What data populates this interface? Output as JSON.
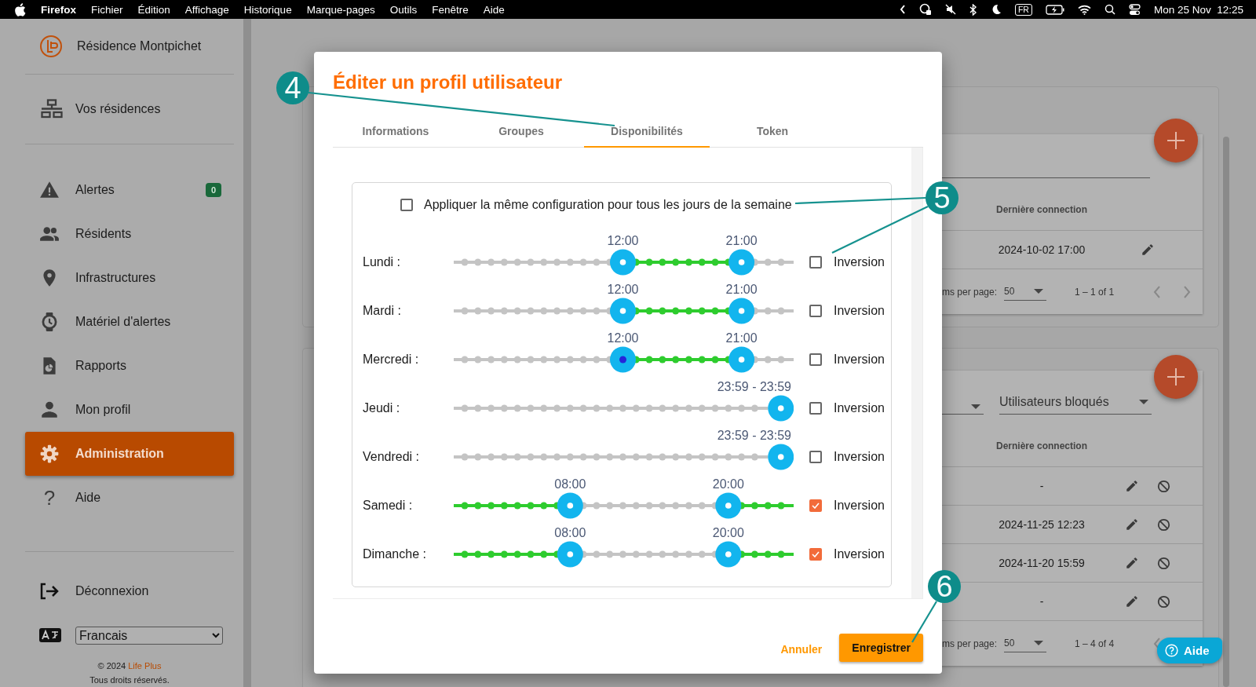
{
  "menu_bar": {
    "app": "Firefox",
    "menus": [
      "Fichier",
      "Édition",
      "Affichage",
      "Historique",
      "Marque-pages",
      "Outils",
      "Fenêtre",
      "Aide"
    ],
    "input_source": "FR",
    "clock": "Mon 25 Nov  12:25"
  },
  "sidebar": {
    "residence": "Résidence Montpichet",
    "top_item": "Vos résidences",
    "items": [
      {
        "label": "Alertes",
        "kind": "alert",
        "badge": "0",
        "selected": false
      },
      {
        "label": "Résidents",
        "kind": "people",
        "selected": false
      },
      {
        "label": "Infrastructures",
        "kind": "pin",
        "selected": false
      },
      {
        "label": "Matériel d'alertes",
        "kind": "watch",
        "selected": false
      },
      {
        "label": "Rapports",
        "kind": "report",
        "selected": false
      },
      {
        "label": "Mon profil",
        "kind": "person",
        "selected": false
      },
      {
        "label": "Administration",
        "kind": "gear",
        "selected": true
      },
      {
        "label": "Aide",
        "kind": "help",
        "glyph": "?",
        "selected": false
      }
    ],
    "logout": "Déconnexion",
    "language": "Francais",
    "copyright": "© 2024 ",
    "brand": "Life Plus",
    "rights": "Tous droits réservés."
  },
  "panels": [
    {
      "filters": [
        {
          "kind": "field"
        }
      ],
      "column_header": "Dernière connection",
      "rows": [
        "2024-10-02 17:00"
      ],
      "items_label": "ms per page:",
      "per_page": "50",
      "range": "1 – 1 of 1",
      "pager_next": true
    },
    {
      "filters": [
        {
          "kind": "select"
        },
        {
          "kind": "select",
          "value": "Utilisateurs bloqués"
        }
      ],
      "column_header": "Dernière connection",
      "block_column": true,
      "rows": [
        "-",
        "2024-11-25 12:23",
        "2024-11-20 15:59",
        "-"
      ],
      "items_label": "ms per page:",
      "per_page": "50",
      "range": "1 – 4 of 4"
    }
  ],
  "dialog": {
    "title": "Éditer un profil utilisateur",
    "tabs": [
      {
        "label": "Informations",
        "selected": false
      },
      {
        "label": "Groupes",
        "selected": false
      },
      {
        "label": "Disponibilités",
        "selected": true
      },
      {
        "label": "Token",
        "selected": false
      }
    ],
    "apply_all": {
      "label": "Appliquer la même configuration pour tous les jours de la semaine",
      "checked": false
    },
    "days": [
      {
        "name": "Lundi :",
        "thumbs": [
          {
            "label": "12:00",
            "level": 0.5
          },
          {
            "label": "21:00",
            "level": 0.875
          }
        ],
        "inversion": {
          "label": "Inversion",
          "checked": false
        }
      },
      {
        "name": "Mardi :",
        "thumbs": [
          {
            "label": "12:00",
            "level": 0.5
          },
          {
            "label": "21:00",
            "level": 0.875
          }
        ],
        "inversion": {
          "label": "Inversion",
          "checked": false
        }
      },
      {
        "name": "Mercredi :",
        "thumbs": [
          {
            "label": "12:00",
            "level": 0.5,
            "focused": true
          },
          {
            "label": "21:00",
            "level": 0.875
          }
        ],
        "inversion": {
          "label": "Inversion",
          "checked": false
        }
      },
      {
        "name": "Jeudi :",
        "thumbs": [
          {
            "label": "23:59 - 23:59",
            "level": 0.9993
          }
        ],
        "inversion": {
          "label": "Inversion",
          "checked": false
        }
      },
      {
        "name": "Vendredi :",
        "thumbs": [
          {
            "label": "23:59 - 23:59",
            "level": 0.9993
          }
        ],
        "inversion": {
          "label": "Inversion",
          "checked": false
        }
      },
      {
        "name": "Samedi :",
        "thumbs": [
          {
            "label": "08:00",
            "level": 0.3333
          },
          {
            "label": "20:00",
            "level": 0.8333
          }
        ],
        "inversion": {
          "label": "Inversion",
          "checked": true
        }
      },
      {
        "name": "Dimanche :",
        "thumbs": [
          {
            "label": "08:00",
            "level": 0.3333
          },
          {
            "label": "20:00",
            "level": 0.8333
          }
        ],
        "inversion": {
          "label": "Inversion",
          "checked": true
        }
      }
    ],
    "buttons": [
      {
        "label": "Annuler",
        "kind": "text"
      },
      {
        "label": "Enregistrer",
        "kind": "raised"
      }
    ]
  },
  "help_button": {
    "label": "Aide"
  },
  "callouts": [
    {
      "label": "4"
    },
    {
      "label": "5"
    },
    {
      "label": "6"
    }
  ]
}
